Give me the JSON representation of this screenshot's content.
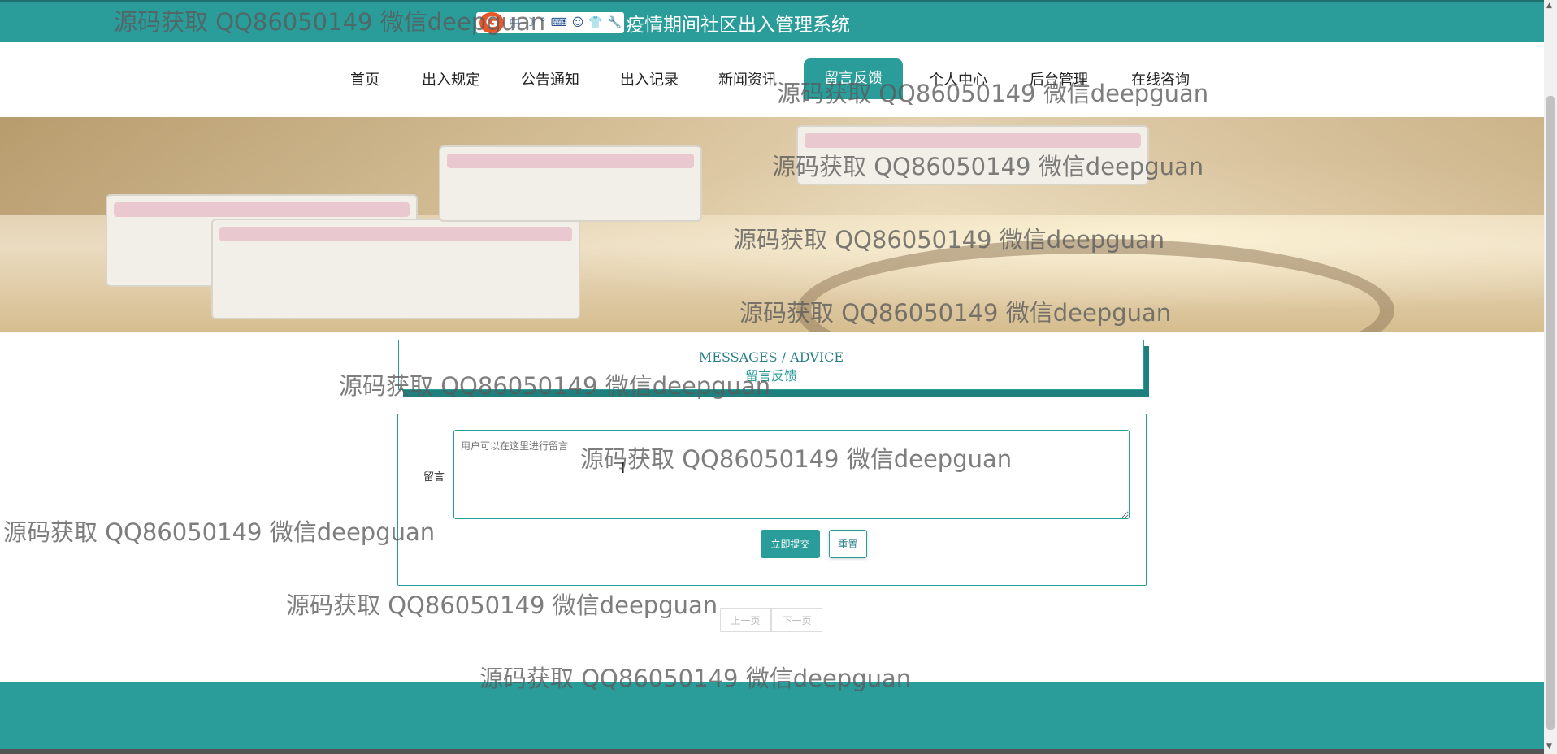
{
  "header": {
    "title": "疫情期间社区出入管理系统"
  },
  "ime_toolbar": {
    "logo": "G",
    "items": [
      "中",
      "☽",
      "°",
      "⌨",
      "☺",
      "👕",
      "🔧"
    ]
  },
  "nav": {
    "items": [
      {
        "label": "首页"
      },
      {
        "label": "出入规定"
      },
      {
        "label": "公告通知"
      },
      {
        "label": "出入记录"
      },
      {
        "label": "新闻资讯"
      },
      {
        "label": "留言反馈"
      },
      {
        "label": "个人中心"
      },
      {
        "label": "后台管理"
      },
      {
        "label": "在线咨询"
      }
    ],
    "active": "留言反馈"
  },
  "section": {
    "title_en": "MESSAGES / ADVICE",
    "title_cn": "留言反馈"
  },
  "form": {
    "label": "留言",
    "placeholder": "用户可以在这里进行留言",
    "submit_label": "立即提交",
    "reset_label": "重置"
  },
  "pager": {
    "prev": "上一页",
    "next": "下一页"
  },
  "watermark": {
    "text": "源码获取 QQ86050149 微信deepguan"
  },
  "colors": {
    "primary": "#2a9d9b",
    "dark": "#1f7f7d"
  }
}
